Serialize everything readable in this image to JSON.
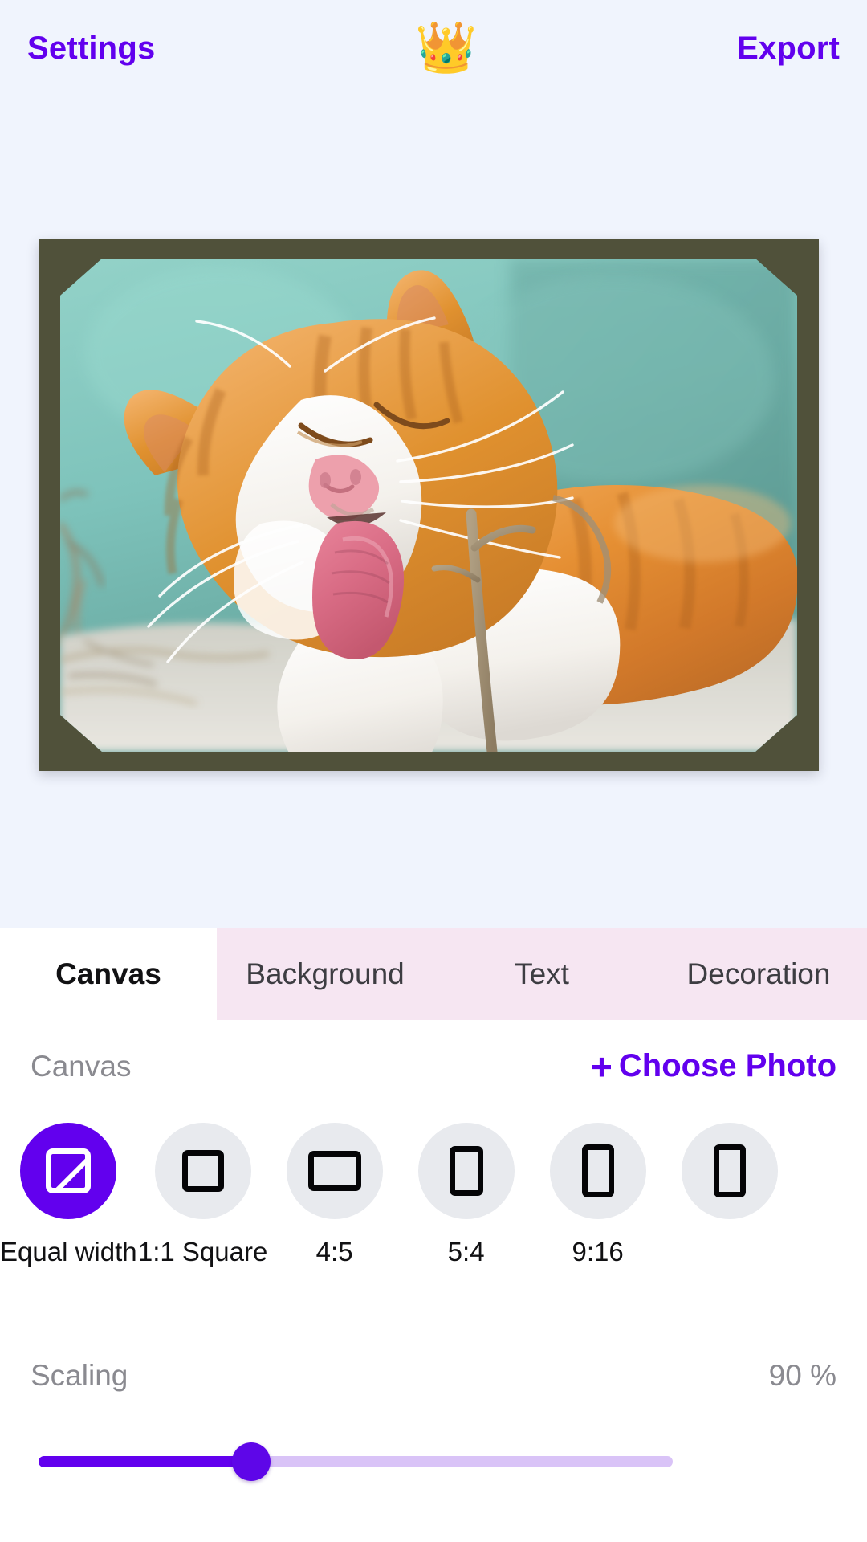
{
  "colors": {
    "accent": "#6200EE",
    "page_background": "#F0F4FD",
    "sheet_background": "#FFFFFF",
    "tabbar_background": "#F6E6F2",
    "chip_background": "#E8EAEE",
    "frame_color": "#50513A",
    "slider_track": "#D9C3F7",
    "muted_text": "#8A8A90"
  },
  "header": {
    "settings_label": "Settings",
    "export_label": "Export",
    "crown_icon": "crown-icon",
    "crown_glyph": "👑"
  },
  "stage": {
    "frame_name": "photo-frame",
    "photo_alt": "Ginger and white cat licking its paw against a mint green background",
    "mask_shape": "octagon"
  },
  "tabs": [
    {
      "label": "Canvas",
      "active": true
    },
    {
      "label": "Background",
      "active": false
    },
    {
      "label": "Text",
      "active": false
    },
    {
      "label": "Decoration",
      "active": false
    }
  ],
  "canvas_section": {
    "title": "Canvas",
    "choose_photo_label": "Choose Photo",
    "plus_glyph": "+"
  },
  "aspect_ratios": [
    {
      "label": "Equal width",
      "icon": "equal-width-icon",
      "selected": true
    },
    {
      "label": "1:1 Square",
      "icon": "square-icon",
      "selected": false
    },
    {
      "label": "4:5",
      "icon": "landscape-rect-icon",
      "selected": false
    },
    {
      "label": "5:4",
      "icon": "portrait-rect-icon",
      "selected": false
    },
    {
      "label": "9:16",
      "icon": "tall-portrait-icon",
      "selected": false
    },
    {
      "label": "",
      "icon": "tall-portrait-icon",
      "selected": false
    }
  ],
  "scaling": {
    "label": "Scaling",
    "value_text": "90 %",
    "value": 90,
    "min": 0,
    "max": 100,
    "fill_percent": 33.5
  }
}
